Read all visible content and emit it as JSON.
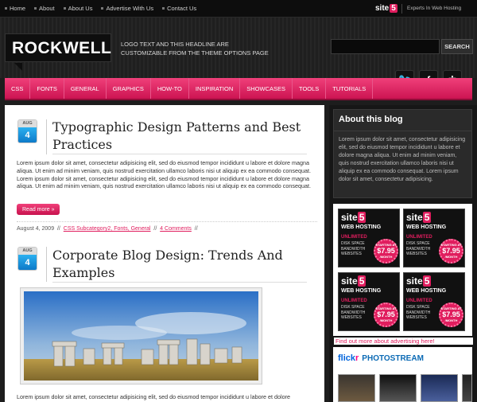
{
  "topnav": {
    "items": [
      "Home",
      "About",
      "About Us",
      "Advertise With Us",
      "Contact Us"
    ],
    "brand": "site",
    "brand_num": "5",
    "tagline": "Experts In Web Hosting"
  },
  "header": {
    "logo": "ROCKWELL",
    "tagline_1": "LOGO TEXT AND THIS HEADLINE ARE",
    "tagline_2": "CUSTOMIZABLE FROM THE THEME OPTIONS PAGE",
    "search_placeholder": "",
    "search_button": "SEARCH"
  },
  "nav": {
    "items": [
      "CSS",
      "FONTS",
      "GENERAL",
      "GRAPHICS",
      "HOW-TO",
      "INSPIRATION",
      "SHOWCASES",
      "TOOLS",
      "TUTORIALS"
    ]
  },
  "social": [
    "twitter-icon",
    "facebook-icon",
    "rss-icon"
  ],
  "posts": [
    {
      "month": "AUG",
      "day": "4",
      "title_1": "Typographic Design Patterns and Best",
      "title_2": "Practices",
      "excerpt": "Lorem ipsum dolor sit amet, consectetur adipisicing elit, sed do eiusmod tempor incididunt u labore et dolore magna aliqua. Ut enim ad minim veniam, quis nostrud exercitation ullamco laboris nisi ut aliquip ex ea commodo consequat. Lorem ipsum dolor sit amet, consectetur adipisicing elit, sed do eiusmod tempor incididunt u labore et dolore magna aliqua. Ut enim ad minim veniam, quis nostrud exercitation ullamco laboris nisi ut aliquip ex ea commodo consequat.",
      "readmore": "Read more »",
      "date": "August 4, 2009",
      "sep": "//",
      "categories": "CSS Subcategory2, Fonts, General",
      "comments": "4 Comments"
    },
    {
      "month": "AUG",
      "day": "4",
      "title_1": "Corporate Blog Design: Trends And",
      "title_2": "Examples",
      "excerpt": "Lorem ipsum dolor sit amet, consectetur adipisicing elit, sed do eiusmod tempor incididunt u labore et dolore"
    }
  ],
  "sidebar": {
    "about_title": "About this blog",
    "about_text": "Lorem ipsum dolor sit amet, consectetur adipisicing elit, sed do eiusmod tempor incididunt u labore et dolore magna aliqua. Ut enim ad minim veniam, quis nostrud exercitation ullamco laboris nisi ut aliquip ex ea commodo consequat. Lorem ipsum dolor sit amet, consectetur adipisicing.",
    "ad": {
      "brand": "site",
      "brand_num": "5",
      "web_hosting": "WEB HOSTING",
      "unlimited": "UNLIMITED",
      "features": "DISK SPACE BANDWIDTH WEBSITES",
      "starting": "STARTING AT",
      "price": "$7.95",
      "month": "/MONTH"
    },
    "ad_link": "Find out more about advertising here!",
    "flickr_1": "flick",
    "flickr_2": "r",
    "flickr_3": "PHOTOSTREAM"
  }
}
